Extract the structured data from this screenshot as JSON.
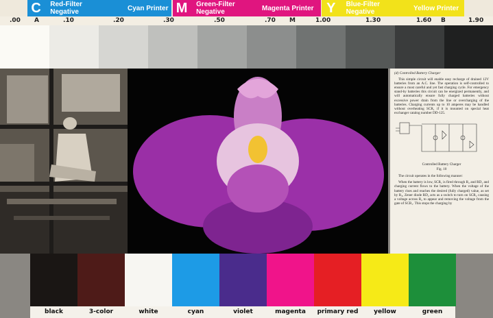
{
  "filter_strip": {
    "segments": [
      {
        "letter": "C",
        "label": "Red-Filter Negative",
        "color": "#1a8fd6"
      },
      {
        "letter": "",
        "label": "Cyan Printer",
        "color": "#1a8fd6"
      },
      {
        "letter": "M",
        "label": "Green-Filter Negative",
        "color": "#e0157f"
      },
      {
        "letter": "",
        "label": "Magenta Printer",
        "color": "#e0157f"
      },
      {
        "letter": "Y",
        "label": "Blue-Filter Negative",
        "color": "#f2e21a"
      },
      {
        "letter": "",
        "label": "Yellow Printer",
        "color": "#f2e21a"
      }
    ]
  },
  "density_scale": {
    "labels": [
      ".00",
      "A",
      ".10",
      ".20",
      ".30",
      ".50",
      ".70",
      "M",
      "1.00",
      "1.30",
      "1.60",
      "B",
      "1.90"
    ]
  },
  "document": {
    "caption": "(d) Controlled Battery Charger",
    "para1": "This simple circuit will enable easy recharge of drained 12V batteries from an A.C. line. The operation is self-controlled to ensure a most careful and yet fast charging cycle. For emergency stand-by batteries this circuit can be energized permanently, and will automatically ensure fully charged batteries without excessive power drain from the line or overcharging of the batteries. Charging currents up to 10 amperes may be handled without overheating SCR₁ if it is mounted on special heat exchanger catalog number DD-125.",
    "figure_caption": "Controlled Battery Charger",
    "figure_number": "Fig. 10",
    "para2": "The circuit operates in the following manner:",
    "para3": "When the battery is low, SCR₁ is fired through R₂ and RD₁ and charging current flows to the battery. When the voltage of the battery rises and reaches the desired (fully charged) value, as set by R₃, Zener diode RD₂ acts as a switch to turn on SCR₂ causing a voltage across R₂ to appear and removing the voltage from the gate of SCR₁. This stops the charging by"
  },
  "patches": [
    {
      "label": "black",
      "color": "#1a1614"
    },
    {
      "label": "3-color",
      "color": "#4e1b18"
    },
    {
      "label": "white",
      "color": "#f7f6f2"
    },
    {
      "label": "cyan",
      "color": "#1d9be6"
    },
    {
      "label": "violet",
      "color": "#4a2c8c"
    },
    {
      "label": "magenta",
      "color": "#f0148a"
    },
    {
      "label": "primary red",
      "color": "#e51f24"
    },
    {
      "label": "yellow",
      "color": "#f6ea17"
    },
    {
      "label": "green",
      "color": "#1d8f3a"
    }
  ]
}
